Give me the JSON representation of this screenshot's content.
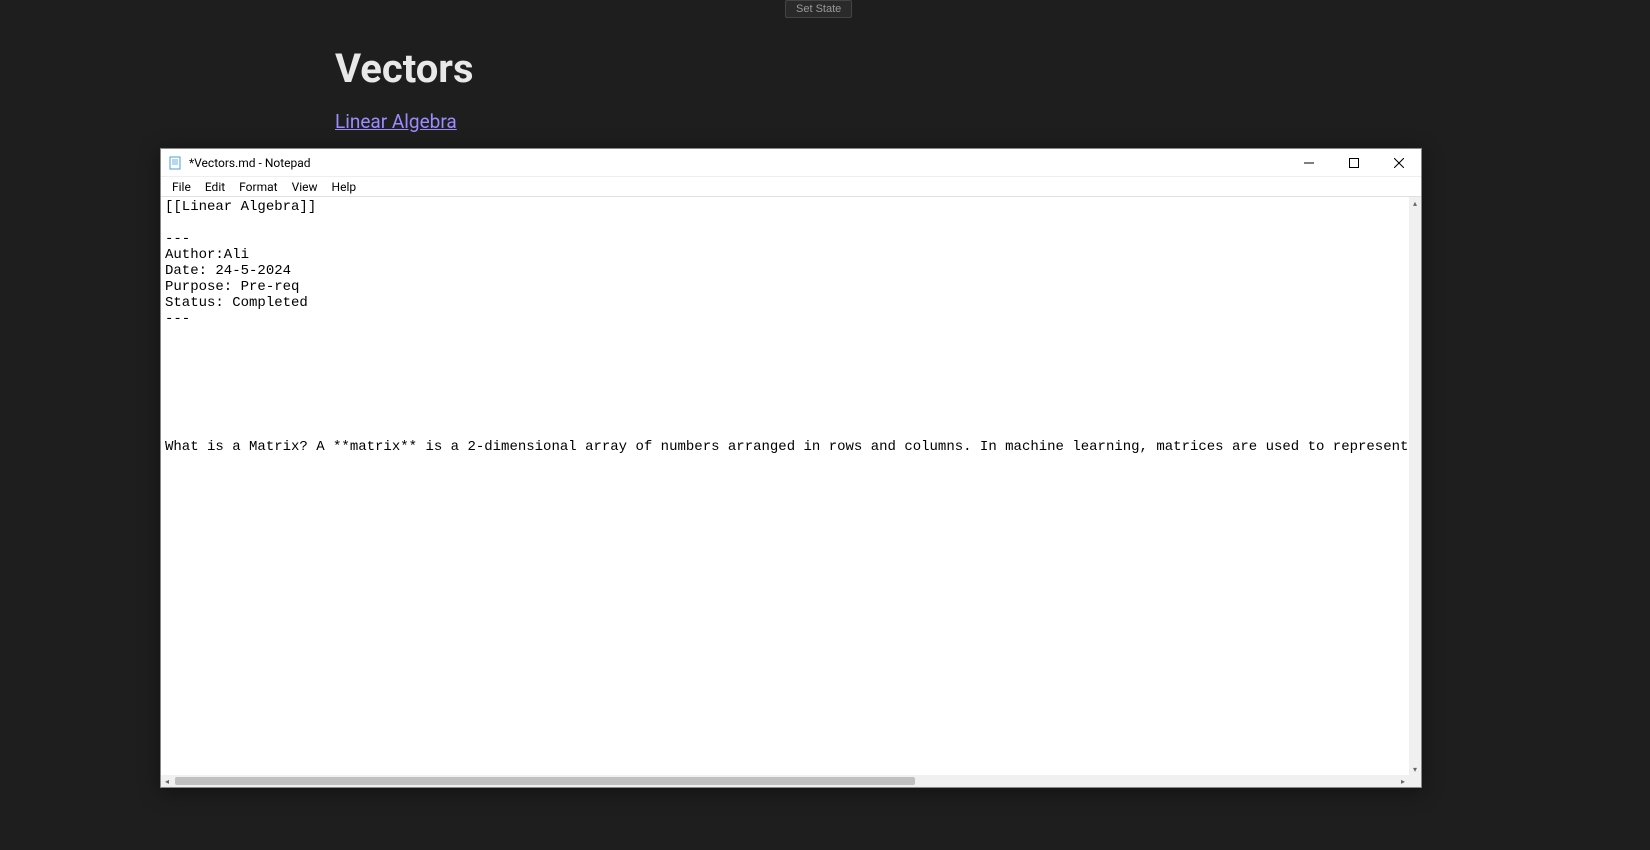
{
  "set_state_label": "Set State",
  "background": {
    "title": "Vectors",
    "link": "Linear Algebra"
  },
  "notepad": {
    "title": "*Vectors.md - Notepad",
    "menu": {
      "file": "File",
      "edit": "Edit",
      "format": "Format",
      "view": "View",
      "help": "Help"
    },
    "content": "[[Linear Algebra]]\n\n---\nAuthor:Ali\nDate: 24-5-2024\nPurpose: Pre-req\nStatus: Completed\n---\n\n\n\n\n\n\n\nWhat is a Matrix? A **matrix** is a 2-dimensional array of numbers arranged in rows and columns. In machine learning, matrices are used to represent datasets (where each row r"
  }
}
